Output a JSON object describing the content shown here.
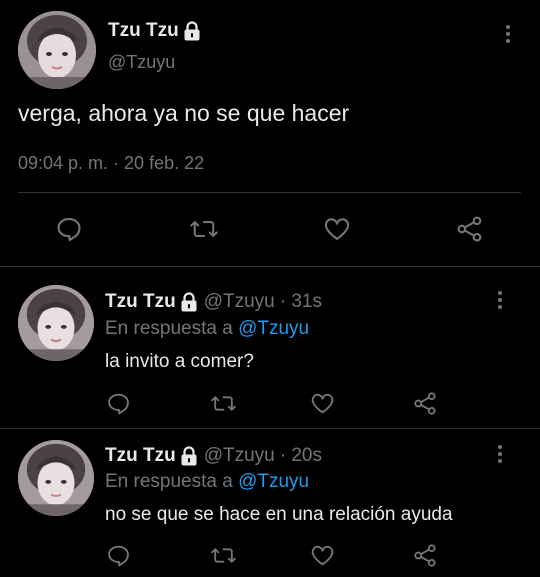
{
  "main_tweet": {
    "display_name": "Tzu Tzu",
    "handle": "@Tzuyu",
    "text": "verga, ahora ya no se que hacer",
    "timestamp": "09:04 p. m. · 20 feb. 22"
  },
  "replies": [
    {
      "display_name": "Tzu Tzu",
      "handle": "@Tzuyu",
      "time_ago": "· 31s",
      "reply_prefix": "En respuesta a",
      "reply_to": "@Tzuyu",
      "text": "la invito a comer?"
    },
    {
      "display_name": "Tzu Tzu",
      "handle": "@Tzuyu",
      "time_ago": "· 20s",
      "reply_prefix": "En respuesta a",
      "reply_to": "@Tzuyu",
      "text": "no se que se hace en una relación ayuda"
    }
  ],
  "icons": {
    "protected": "lock-icon",
    "more": "more-vertical-icon",
    "reply": "reply-icon",
    "retweet": "retweet-icon",
    "like": "heart-icon",
    "share": "share-icon"
  },
  "colors": {
    "background": "#000000",
    "text": "#e7e9ea",
    "muted": "#71767b",
    "link": "#1d9bf0",
    "divider": "#2f3336"
  }
}
